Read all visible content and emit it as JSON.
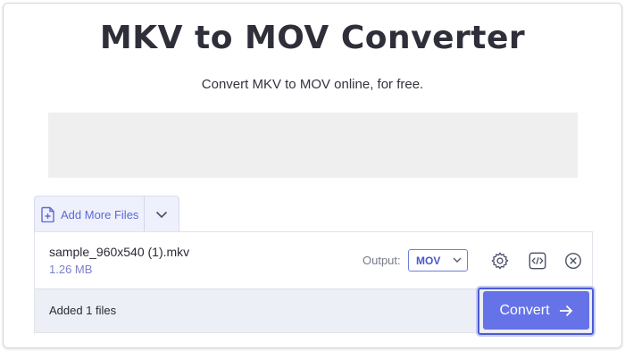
{
  "page": {
    "title": "MKV to MOV Converter",
    "subtitle": "Convert MKV to MOV online, for free."
  },
  "toolbar": {
    "add_files_label": "Add More Files",
    "add_files_icon": "file-plus-icon",
    "dropdown_icon": "chevron-down-icon"
  },
  "file": {
    "name": "sample_960x540 (1).mkv",
    "size": "1.26 MB",
    "output_label": "Output:",
    "output_value": "MOV",
    "settings_icon": "gear-icon",
    "embed_icon": "code-icon",
    "remove_icon": "close-circle-icon"
  },
  "footer": {
    "added_text": "Added 1 files",
    "convert_label": "Convert",
    "convert_icon": "arrow-right-icon"
  },
  "colors": {
    "accent": "#6572e8",
    "link": "#5b6ad6",
    "title": "#2f2f3a"
  }
}
